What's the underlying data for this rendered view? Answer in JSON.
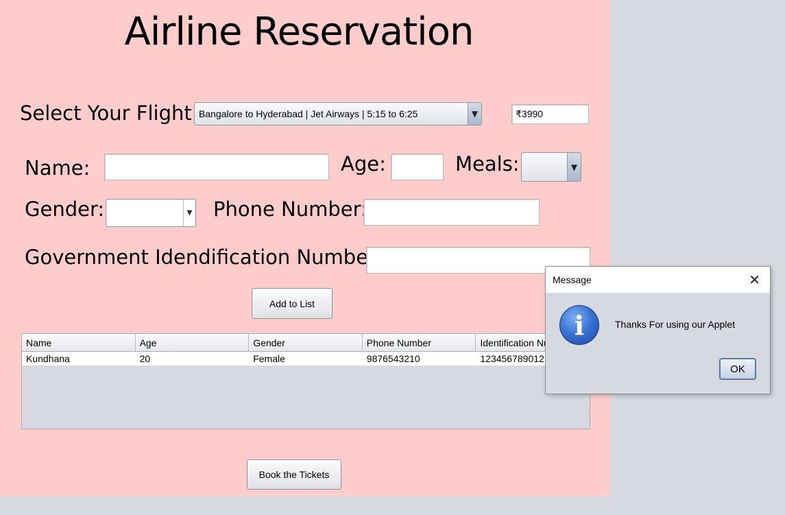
{
  "app": {
    "title": "Airline Reservation"
  },
  "flight": {
    "label": "Select Your Flight:",
    "selected": "Bangalore to Hyderabad | Jet Airways | 5:15 to 6:25",
    "price": "₹3990"
  },
  "form": {
    "name_label": "Name:",
    "name_value": "",
    "age_label": "Age:",
    "age_value": "",
    "meals_label": "Meals:",
    "meals_value": "",
    "gender_label": "Gender:",
    "gender_value": "",
    "phone_label": "Phone Number:",
    "phone_value": "",
    "gov_id_label": "Government Idendification Number:",
    "gov_id_value": ""
  },
  "buttons": {
    "add_to_list": "Add to List",
    "book_tickets": "Book the Tickets"
  },
  "table": {
    "columns": [
      "Name",
      "Age",
      "Gender",
      "Phone Number",
      "Identification Number"
    ],
    "rows": [
      [
        "Kundhana",
        "20",
        "Female",
        "9876543210",
        "123456789012"
      ]
    ]
  },
  "dialog": {
    "title": "Message",
    "message": "Thanks For using our Applet",
    "ok_label": "OK",
    "icon": "info-icon"
  },
  "colors": {
    "panel_bg": "#ffcccc",
    "window_bg": "#d6d9e0"
  }
}
